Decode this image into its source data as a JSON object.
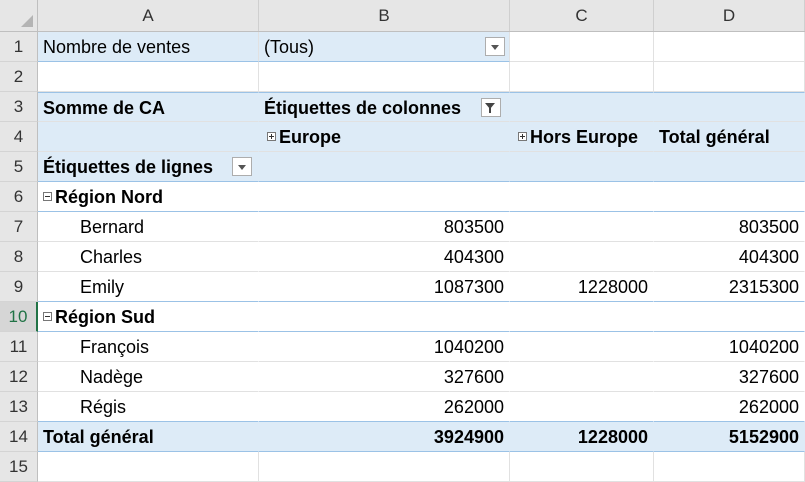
{
  "columns": [
    "A",
    "B",
    "C",
    "D"
  ],
  "rows": [
    "1",
    "2",
    "3",
    "4",
    "5",
    "6",
    "7",
    "8",
    "9",
    "10",
    "11",
    "12",
    "13",
    "14",
    "15"
  ],
  "filter": {
    "label": "Nombre de ventes",
    "value": "(Tous)"
  },
  "pivot": {
    "values_label": "Somme de CA",
    "column_labels": "Étiquettes de colonnes",
    "row_labels": "Étiquettes de lignes",
    "col_europe": "Europe",
    "col_hors_europe": "Hors Europe",
    "col_total": "Total général",
    "groups": [
      {
        "name": "Région Nord",
        "items": [
          {
            "name": "Bernard",
            "europe": "803500",
            "hors": "",
            "total": "803500"
          },
          {
            "name": "Charles",
            "europe": "404300",
            "hors": "",
            "total": "404300"
          },
          {
            "name": "Emily",
            "europe": "1087300",
            "hors": "1228000",
            "total": "2315300"
          }
        ]
      },
      {
        "name": "Région Sud",
        "items": [
          {
            "name": "François",
            "europe": "1040200",
            "hors": "",
            "total": "1040200"
          },
          {
            "name": "Nadège",
            "europe": "327600",
            "hors": "",
            "total": "327600"
          },
          {
            "name": "Régis",
            "europe": "262000",
            "hors": "",
            "total": "262000"
          }
        ]
      }
    ],
    "grand_total": {
      "label": "Total général",
      "europe": "3924900",
      "hors": "1228000",
      "total": "5152900"
    }
  },
  "icons": {
    "filter_dropdown": "dropdown-arrow-icon",
    "active_filter": "filter-icon",
    "expand": "plus-box-icon",
    "collapse": "minus-box-icon"
  },
  "colors": {
    "header_bg": "#e6e6e6",
    "pivot_band": "#ddebf7",
    "pivot_line": "#9bc2e6",
    "selected_row": "#217346"
  }
}
